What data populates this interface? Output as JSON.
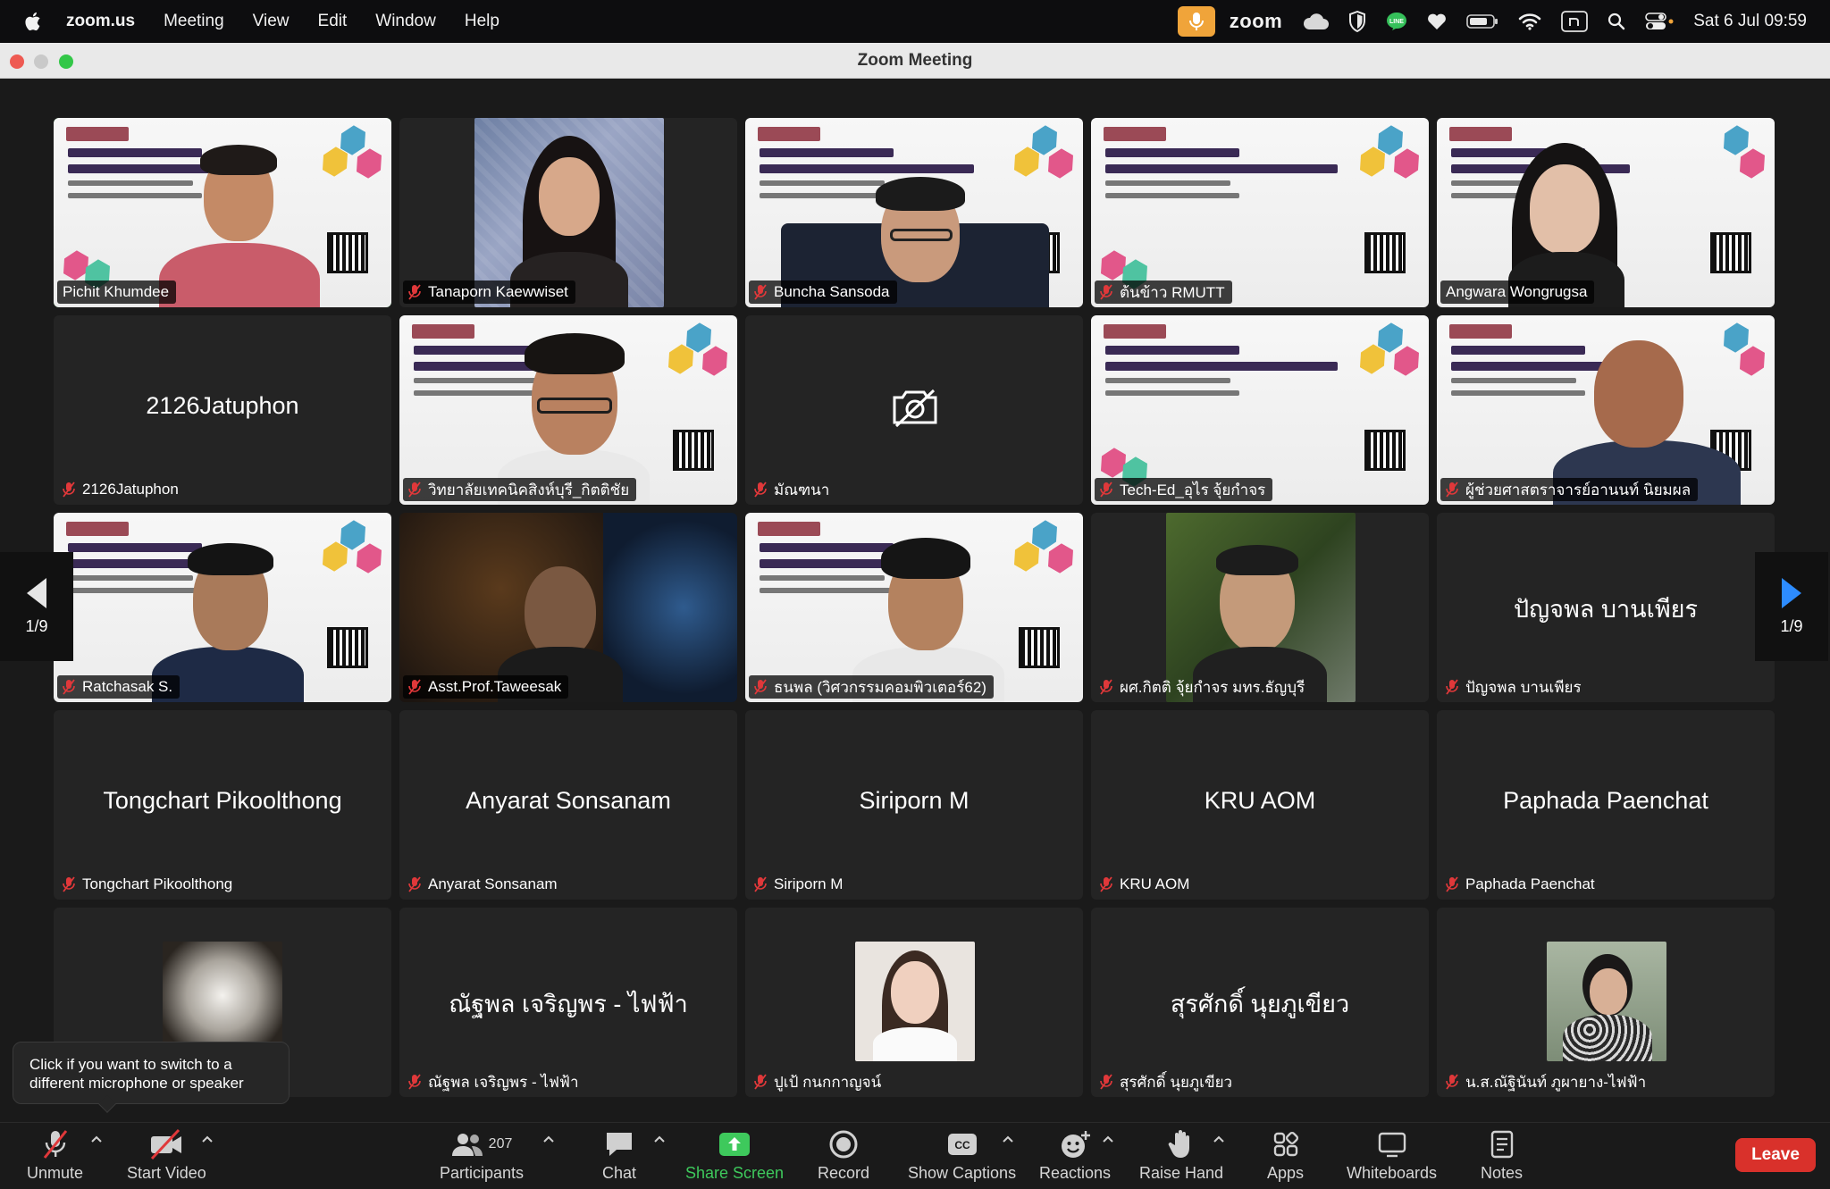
{
  "menubar": {
    "app": "zoom.us",
    "items": [
      "Meeting",
      "View",
      "Edit",
      "Window",
      "Help"
    ],
    "zoom_label": "zoom",
    "clock": "Sat 6 Jul  09:59"
  },
  "window": {
    "title": "Zoom Meeting"
  },
  "gallery": {
    "page_left": "1/9",
    "page_right": "1/9",
    "tiles": [
      {
        "name": "Pichit Khumdee",
        "type": "slide",
        "muted": false,
        "active": true
      },
      {
        "name": "Tanaporn Kaewwiset",
        "type": "video",
        "muted": true
      },
      {
        "name": "Buncha Sansoda",
        "type": "slide",
        "muted": true
      },
      {
        "name": "ต้นข้าว RMUTT",
        "type": "slide",
        "muted": true
      },
      {
        "name": "Angwara Wongrugsa",
        "type": "slide",
        "muted": false
      },
      {
        "name": "2126Jatuphon",
        "type": "name",
        "display": "2126Jatuphon",
        "muted": true
      },
      {
        "name": "วิทยาลัยเทคนิคสิงห์บุรี_กิตติชัย",
        "type": "slide",
        "muted": true
      },
      {
        "name": "มัณฑนา",
        "type": "camera-off",
        "muted": true
      },
      {
        "name": "Tech-Ed_อุไร จุ้ยกำจร",
        "type": "slide",
        "muted": true
      },
      {
        "name": "ผู้ช่วยศาสตราจารย์อานนท์ นิยมผล",
        "type": "slide",
        "muted": true
      },
      {
        "name": "Ratchasak S.",
        "type": "slide",
        "muted": true
      },
      {
        "name": "Asst.Prof.Taweesak",
        "type": "video",
        "muted": true
      },
      {
        "name": "ธนพล (วิศวกรรมคอมพิวเตอร์62)",
        "type": "slide",
        "muted": true
      },
      {
        "name": "ผศ.กิตติ จุ้ยกำจร มทร.ธัญบุรี",
        "type": "photo",
        "muted": true
      },
      {
        "name": "ปัญจพล บานเพียร",
        "type": "name",
        "display": "ปัญจพล บานเพียร",
        "muted": true
      },
      {
        "name": "Tongchart Pikoolthong",
        "type": "name",
        "display": "Tongchart Pikoolthong",
        "muted": true
      },
      {
        "name": "Anyarat Sonsanam",
        "type": "name",
        "display": "Anyarat Sonsanam",
        "muted": true
      },
      {
        "name": "Siriporn M",
        "type": "name",
        "display": "Siriporn M",
        "muted": true
      },
      {
        "name": "KRU AOM",
        "type": "name",
        "display": "KRU AOM",
        "muted": true
      },
      {
        "name": "Paphada Paenchat",
        "type": "name",
        "display": "Paphada Paenchat",
        "muted": true
      },
      {
        "name": "",
        "type": "photo",
        "muted": false
      },
      {
        "name": "ณัฐพล เจริญพร - ไฟฟ้า",
        "type": "name",
        "display": "ณัฐพล เจริญพร - ไฟฟ้า",
        "muted": true
      },
      {
        "name": "ปูเป้ กนกกาญจน์",
        "type": "photo",
        "muted": true
      },
      {
        "name": "สุรศักดิ์ นุยภูเขียว",
        "type": "name",
        "display": "สุรศักดิ์ นุยภูเขียว",
        "muted": true
      },
      {
        "name": "น.ส.ณัฐินันท์ ภูผายาง-ไฟฟ้า",
        "type": "photo",
        "muted": true
      }
    ]
  },
  "tooltip": {
    "text": "Click if you want to switch to a different microphone or speaker"
  },
  "toolbar": {
    "unmute": "Unmute",
    "start_video": "Start Video",
    "participants": "Participants",
    "participants_count": "207",
    "chat": "Chat",
    "share_screen": "Share Screen",
    "record": "Record",
    "show_captions": "Show Captions",
    "reactions": "Reactions",
    "raise_hand": "Raise Hand",
    "apps": "Apps",
    "whiteboards": "Whiteboards",
    "notes": "Notes",
    "leave": "Leave"
  },
  "colors": {
    "active_speaker": "#2fc44b",
    "leave": "#d9312b",
    "share": "#3ec95c",
    "mic_pill": "#f0a43a"
  }
}
